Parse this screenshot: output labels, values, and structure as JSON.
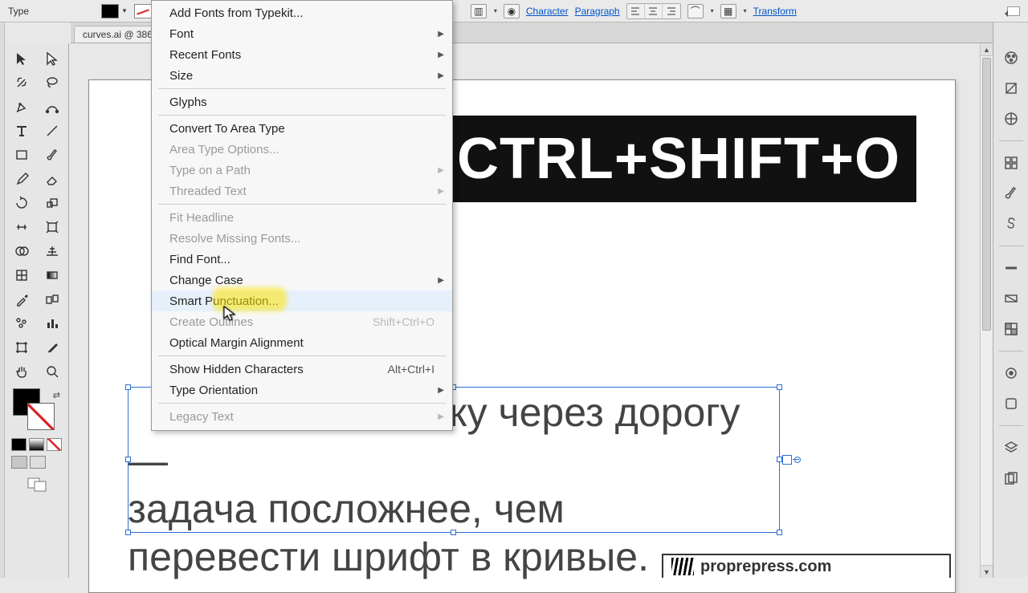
{
  "options": {
    "left_label": "Type",
    "character_link": "Character",
    "paragraph_link": "Paragraph",
    "transform_link": "Transform"
  },
  "doc_tab": "curves.ai @ 386",
  "menu": {
    "items": [
      {
        "label": "Add Fonts from Typekit...",
        "disabled": false
      },
      {
        "label": "Font",
        "sub": true
      },
      {
        "label": "Recent Fonts",
        "sub": true
      },
      {
        "label": "Size",
        "sub": true
      },
      {
        "sep": true
      },
      {
        "label": "Glyphs"
      },
      {
        "sep": true
      },
      {
        "label": "Convert To Area Type"
      },
      {
        "label": "Area Type Options...",
        "disabled": true
      },
      {
        "label": "Type on a Path",
        "sub": true,
        "disabled": true
      },
      {
        "label": "Threaded Text",
        "sub": true,
        "disabled": true
      },
      {
        "sep": true
      },
      {
        "label": "Fit Headline",
        "disabled": true
      },
      {
        "label": "Resolve Missing Fonts...",
        "disabled": true
      },
      {
        "label": "Find Font..."
      },
      {
        "label": "Change Case",
        "sub": true
      },
      {
        "label": "Smart Punctuation...",
        "hover": true
      },
      {
        "label": "Create Outlines",
        "shortcut": "Shift+Ctrl+O",
        "disabled": true
      },
      {
        "label": "Optical Margin Alignment"
      },
      {
        "sep": true
      },
      {
        "label": "Show Hidden Characters",
        "shortcut": "Alt+Ctrl+I"
      },
      {
        "label": "Type Orientation",
        "sub": true
      },
      {
        "sep": true
      },
      {
        "label": "Legacy Text",
        "sub": true,
        "disabled": true
      }
    ]
  },
  "canvas": {
    "headline": "CTRL+SHIFT+O",
    "body_line1": "ку через дорогу —",
    "body_line2": "задача посложнее, чем",
    "body_line3": "перевести шрифт в кривые."
  },
  "watermark": "proprepress.com",
  "right_panels": [
    "color",
    "swatches",
    "stroke",
    "brushes",
    "symbols",
    "layers",
    "transparency",
    "appearance",
    "graphic-styles",
    "align",
    "pathfinder"
  ]
}
